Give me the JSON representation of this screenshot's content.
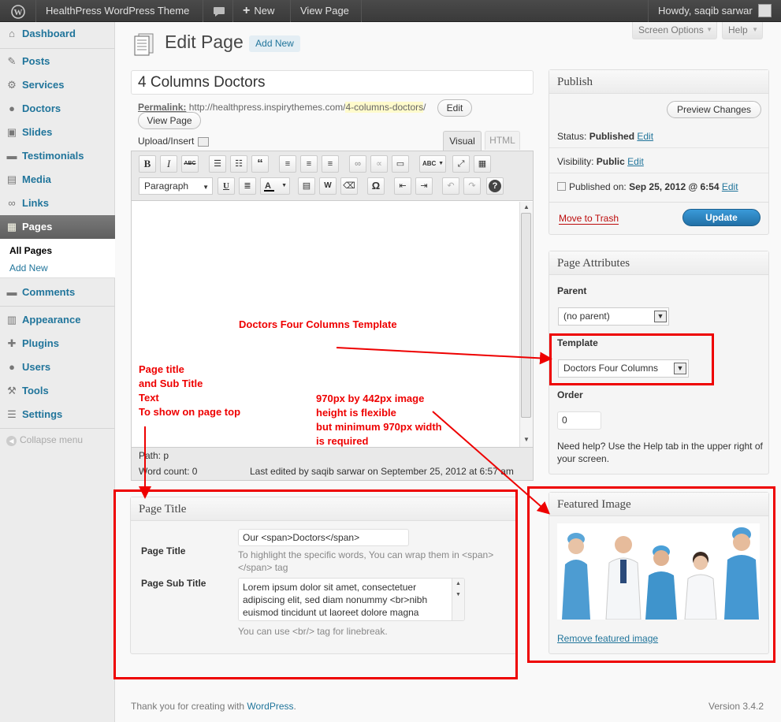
{
  "adminbar": {
    "site_name": "HealthPress WordPress Theme",
    "new_label": "New",
    "view_page": "View Page",
    "howdy": "Howdy, saqib sarwar"
  },
  "sidebar": {
    "items": [
      {
        "label": "Dashboard",
        "icon": "dashboard-icon"
      },
      {
        "label": "Posts",
        "icon": "pin-icon"
      },
      {
        "label": "Services",
        "icon": "gear-icon"
      },
      {
        "label": "Doctors",
        "icon": "users-icon"
      },
      {
        "label": "Slides",
        "icon": "image-icon"
      },
      {
        "label": "Testimonials",
        "icon": "comment-icon"
      },
      {
        "label": "Media",
        "icon": "media-icon"
      },
      {
        "label": "Links",
        "icon": "link-icon"
      },
      {
        "label": "Pages",
        "icon": "page-icon"
      },
      {
        "label": "Comments",
        "icon": "comment-icon"
      },
      {
        "label": "Appearance",
        "icon": "appearance-icon"
      },
      {
        "label": "Plugins",
        "icon": "plugin-icon"
      },
      {
        "label": "Users",
        "icon": "users-icon"
      },
      {
        "label": "Tools",
        "icon": "tools-icon"
      },
      {
        "label": "Settings",
        "icon": "settings-icon"
      }
    ],
    "submenu": [
      "All Pages",
      "Add New"
    ],
    "collapse": "Collapse menu"
  },
  "header": {
    "title": "Edit Page",
    "add_new": "Add New",
    "screen_options": "Screen Options",
    "help": "Help"
  },
  "editor": {
    "post_title": "4 Columns Doctors",
    "permalink_label": "Permalink:",
    "permalink_base": "http://healthpress.inspirythemes.com/",
    "permalink_slug": "4-columns-doctors",
    "permalink_end": "/",
    "edit_button": "Edit",
    "view_page_button": "View Page",
    "upload_insert": "Upload/Insert",
    "tab_visual": "Visual",
    "tab_html": "HTML",
    "format_select": "Paragraph",
    "path": "Path: p",
    "word_count": "Word count: 0",
    "last_edited": "Last edited by saqib sarwar on September 25, 2012 at 6:57 am"
  },
  "publish": {
    "title": "Publish",
    "preview": "Preview Changes",
    "status_label": "Status: ",
    "status_value": "Published",
    "visibility_label": "Visibility: ",
    "visibility_value": "Public",
    "published_on_label": "Published on: ",
    "published_on_value": "Sep 25, 2012 @ 6:54",
    "edit": "Edit",
    "trash": "Move to Trash",
    "update": "Update"
  },
  "attributes": {
    "title": "Page Attributes",
    "parent_label": "Parent",
    "parent_value": "(no parent)",
    "template_label": "Template",
    "template_value": "Doctors Four Columns",
    "order_label": "Order",
    "order_value": "0",
    "help_text": "Need help? Use the Help tab in the upper right of your screen."
  },
  "page_title_box": {
    "title": "Page Title",
    "title_label": "Page Title",
    "title_value": "Our <span>Doctors</span>",
    "title_help": "To highlight the specific words, You can wrap them in <span> </span> tag",
    "subtitle_label": "Page Sub Title",
    "subtitle_value": "Lorem ipsum dolor sit amet, consectetuer adipiscing elit, sed diam nonummy <br>nibh euismod tincidunt ut laoreet dolore magna",
    "subtitle_help": "You can use <br/> tag for linebreak."
  },
  "featured": {
    "title": "Featured Image",
    "remove": "Remove featured image"
  },
  "annotations": {
    "template_note": "Doctors Four Columns Template",
    "title_note": "Page title\nand Sub Title\nText\nTo show on page top",
    "image_note": "970px by 442px image\nheight is flexible\nbut minimum 970px width\nis required"
  },
  "footer": {
    "thanks": "Thank you for creating with ",
    "wordpress": "WordPress",
    "thanks_end": ".",
    "version": "Version 3.4.2"
  },
  "colors": {
    "accent": "#21759b",
    "annotation": "#e00000",
    "update_button": "#2a8ac2"
  }
}
